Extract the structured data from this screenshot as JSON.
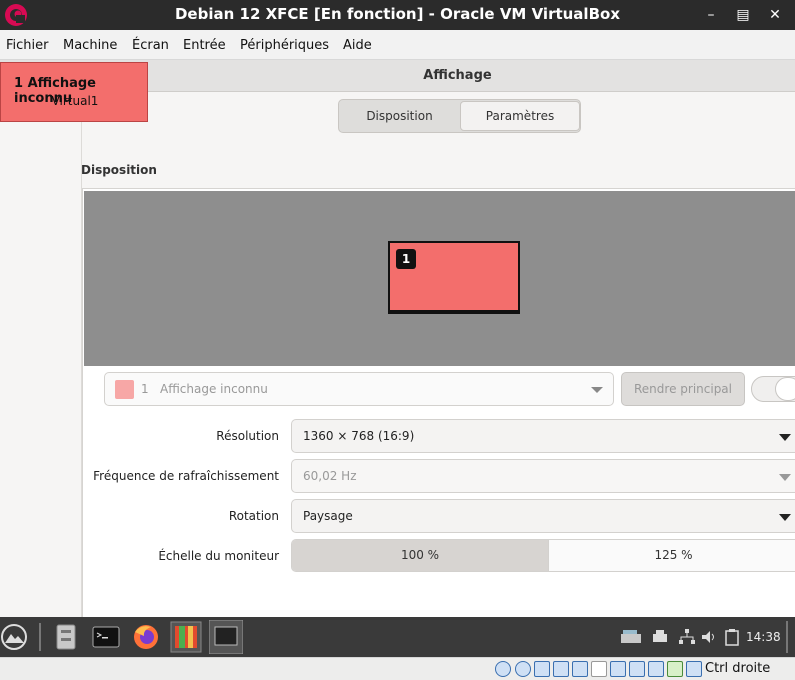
{
  "window": {
    "title": "Debian 12 XFCE [En fonction] - Oracle VM VirtualBox",
    "minimize_icon": "minimize-icon",
    "maximize_icon": "maximize-icon",
    "close_icon": "close-icon"
  },
  "menubar": {
    "items": [
      "Fichier",
      "Machine",
      "Écran",
      "Entrée",
      "Périphériques",
      "Aide"
    ]
  },
  "overlay": {
    "line1": "1  Affichage inconnu",
    "line2": "Virtual1",
    "color": "#f36e6c"
  },
  "header": {
    "title": "Affichage"
  },
  "tabs": [
    {
      "label": "Disposition",
      "active": false
    },
    {
      "label": "Paramètres",
      "active": true
    }
  ],
  "section": {
    "title": "Disposition"
  },
  "preview": {
    "monitor_number": "1"
  },
  "display_select": {
    "number": "1",
    "name": "Affichage inconnu"
  },
  "primary_button": {
    "label": "Rendre principal"
  },
  "settings": {
    "resolution": {
      "label": "Résolution",
      "value": "1360 × 768 (16:9)"
    },
    "refresh": {
      "label": "Fréquence de rafraîchissement",
      "value": "60,02 Hz"
    },
    "rotation": {
      "label": "Rotation",
      "value": "Paysage"
    },
    "scale": {
      "label": "Échelle du moniteur",
      "options": [
        "100 %",
        "125 %"
      ],
      "selected": "100 %"
    }
  },
  "taskbar": {
    "clock": "14:38"
  },
  "statusbar": {
    "host_key": "Ctrl droite"
  },
  "colors": {
    "accent_monitor": "#f36e6c",
    "titlebar": "#2b2b2b",
    "taskbar": "#3a3a3a",
    "preview_bg": "#8e8e8e"
  }
}
